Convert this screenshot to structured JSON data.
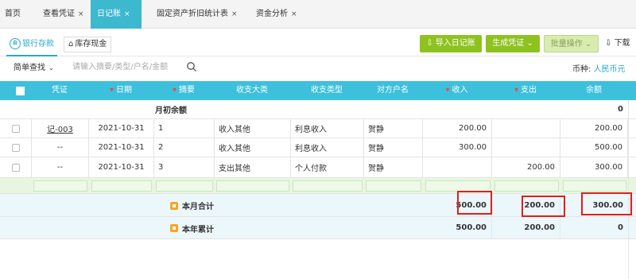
{
  "tabs": [
    {
      "label": "首页",
      "closable": false
    },
    {
      "label": "查看凭证",
      "closable": true
    },
    {
      "label": "日记账",
      "closable": true,
      "active": true
    },
    {
      "label": "固定资产折旧统计表",
      "closable": true
    },
    {
      "label": "资金分析",
      "closable": true
    }
  ],
  "close_glyph": "×",
  "subtabs": {
    "bank": "银行存款",
    "bank_icon_text": "自",
    "cash": "库存现金"
  },
  "toolbar": {
    "import": "导入日记账",
    "generate": "生成凭证",
    "batch": "批量操作",
    "download": "下载"
  },
  "search": {
    "mode": "简单查找",
    "placeholder": "请输入摘要/类型/户名/金额"
  },
  "currency": {
    "label": "币种:",
    "value": "人民币元"
  },
  "columns": [
    "凭证",
    "日期",
    "摘要",
    "收支大类",
    "收支类型",
    "对方户名",
    "收入",
    "支出",
    "余额"
  ],
  "opening": {
    "label": "月初余额",
    "balance": "0"
  },
  "rows": [
    {
      "voucher": "记-003",
      "date": "2021-10-31",
      "summary": "1",
      "category": "收入其他",
      "type": "利息收入",
      "party": "贺静",
      "income": "200.00",
      "expense": "",
      "balance": "200.00"
    },
    {
      "voucher": "--",
      "date": "2021-10-31",
      "summary": "2",
      "category": "收入其他",
      "type": "利息收入",
      "party": "贺静",
      "income": "300.00",
      "expense": "",
      "balance": "500.00"
    },
    {
      "voucher": "--",
      "date": "2021-10-31",
      "summary": "3",
      "category": "支出其他",
      "type": "个人付款",
      "party": "贺静",
      "income": "",
      "expense": "200.00",
      "balance": "300.00"
    }
  ],
  "month_total": {
    "label": "本月合计",
    "income": "500.00",
    "expense": "200.00",
    "balance": "300.00"
  },
  "year_total": {
    "label": "本年累计",
    "income": "500.00",
    "expense": "200.00",
    "balance": "0"
  },
  "colors": {
    "accent": "#3cc0dc",
    "green": "#8ec21f",
    "highlight": "#e0201c"
  }
}
